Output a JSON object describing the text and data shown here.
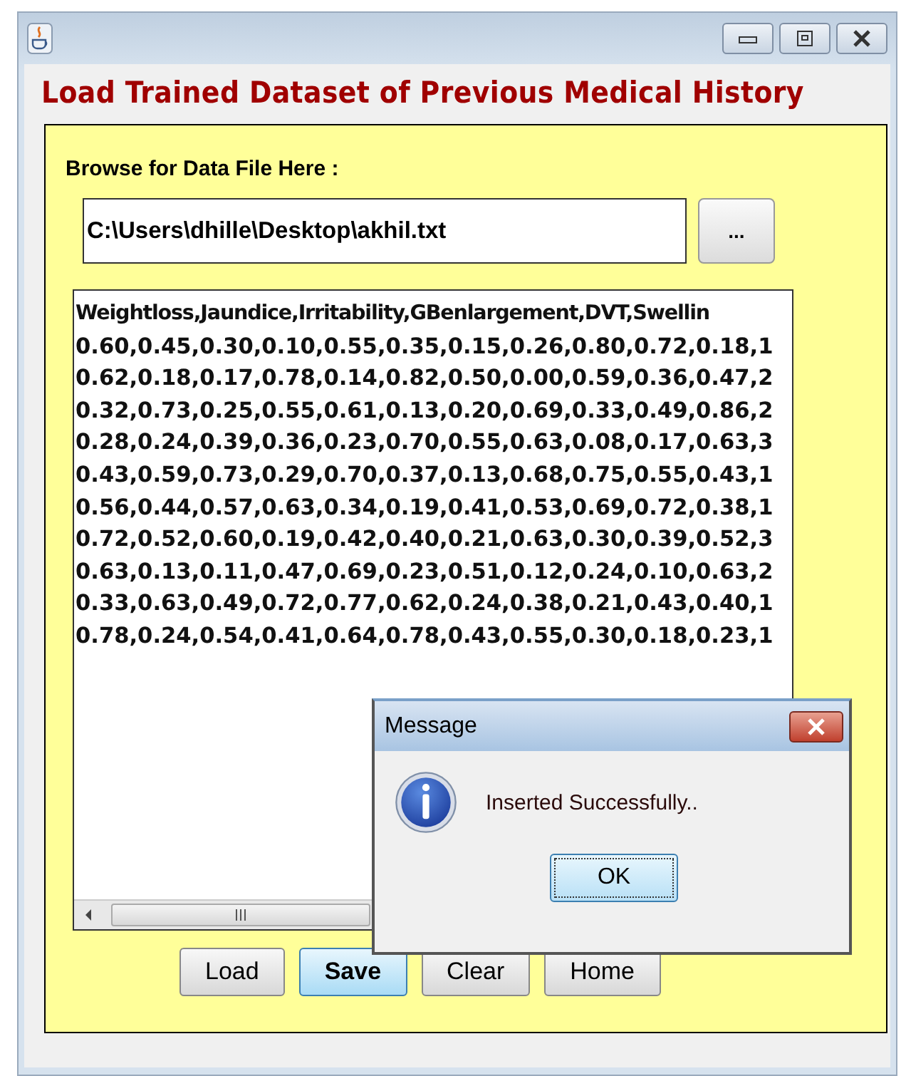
{
  "window": {
    "title": "Load Trained Dataset of Previous Medical History"
  },
  "browse": {
    "label": "Browse for Data File Here :",
    "path": "C:\\Users\\dhille\\Desktop\\akhil.txt",
    "browse_button": "..."
  },
  "data_lines": [
    "Weightloss,Jaundice,Irritability,GBenlargement,DVT,Swellin",
    "0.60,0.45,0.30,0.10,0.55,0.35,0.15,0.26,0.80,0.72,0.18,1",
    "0.62,0.18,0.17,0.78,0.14,0.82,0.50,0.00,0.59,0.36,0.47,2",
    "0.32,0.73,0.25,0.55,0.61,0.13,0.20,0.69,0.33,0.49,0.86,2",
    "0.28,0.24,0.39,0.36,0.23,0.70,0.55,0.63,0.08,0.17,0.63,3",
    "0.43,0.59,0.73,0.29,0.70,0.37,0.13,0.68,0.75,0.55,0.43,1",
    "0.56,0.44,0.57,0.63,0.34,0.19,0.41,0.53,0.69,0.72,0.38,1",
    "0.72,0.52,0.60,0.19,0.42,0.40,0.21,0.63,0.30,0.39,0.52,3",
    "0.63,0.13,0.11,0.47,0.69,0.23,0.51,0.12,0.24,0.10,0.63,2",
    "0.33,0.63,0.49,0.72,0.77,0.62,0.24,0.38,0.21,0.43,0.40,1",
    "0.78,0.24,0.54,0.41,0.64,0.78,0.43,0.55,0.30,0.18,0.23,1"
  ],
  "buttons": [
    {
      "label": "Load",
      "highlighted": false
    },
    {
      "label": "Save",
      "highlighted": true
    },
    {
      "label": "Clear",
      "highlighted": false
    },
    {
      "label": "Home",
      "highlighted": false
    }
  ],
  "dialog": {
    "title": "Message",
    "message": "Inserted Successfully..",
    "ok_button": "OK"
  }
}
